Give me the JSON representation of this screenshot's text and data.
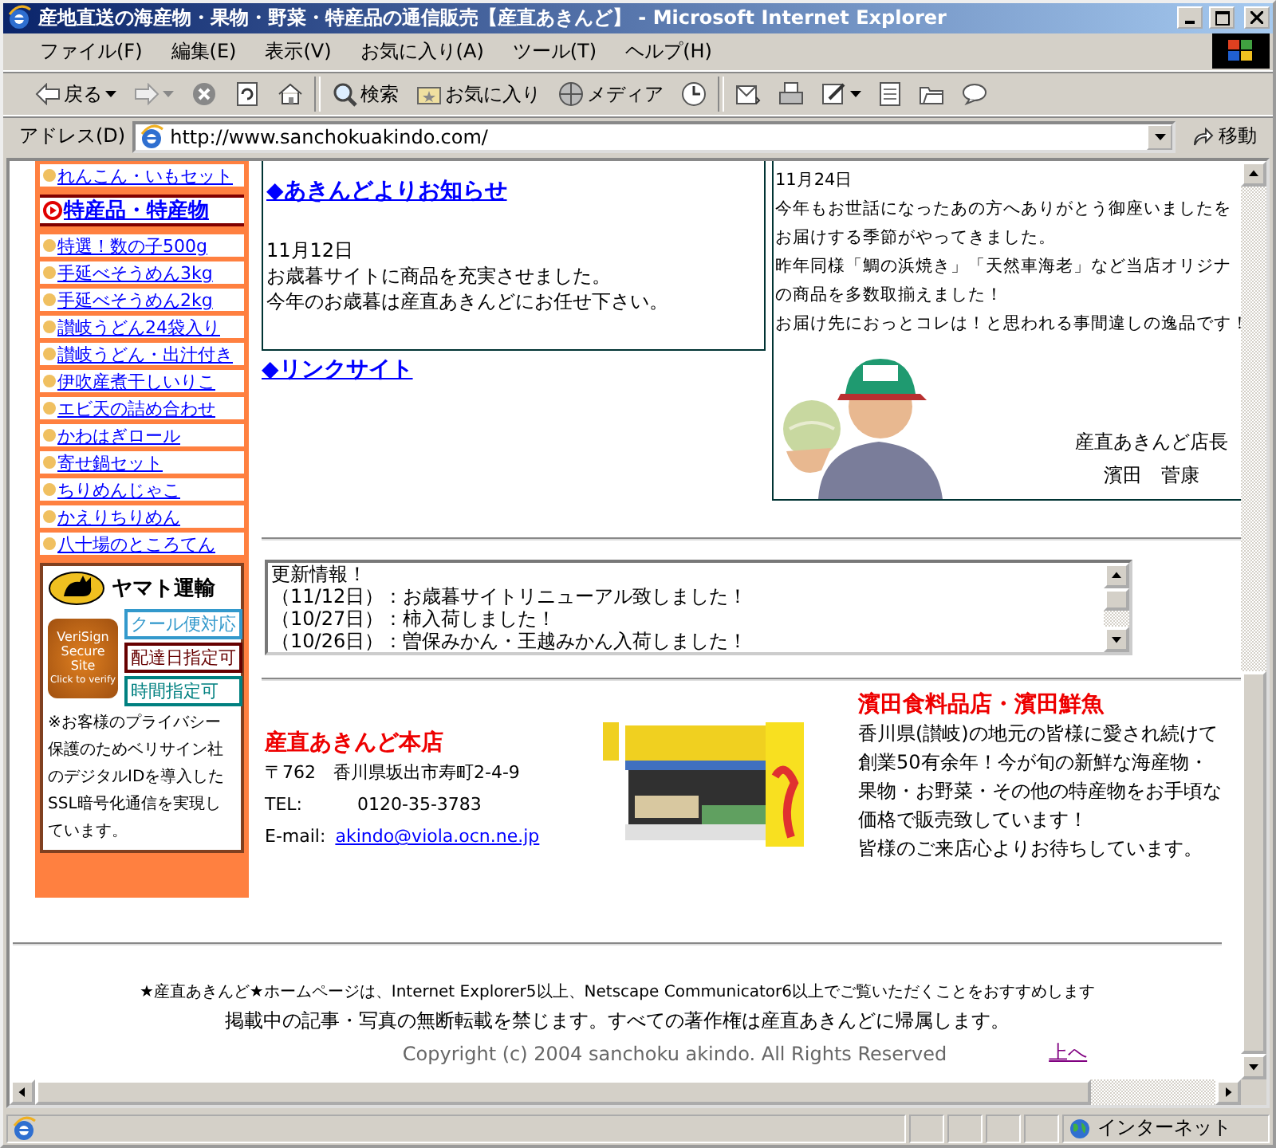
{
  "window": {
    "title": "産地直送の海産物・果物・野菜・特産品の通信販売【産直あきんど】 - Microsoft Internet Explorer"
  },
  "menu": [
    "ファイル(F)",
    "編集(E)",
    "表示(V)",
    "お気に入り(A)",
    "ツール(T)",
    "ヘルプ(H)"
  ],
  "toolbar": [
    {
      "kind": "back",
      "label": "戻る"
    },
    {
      "kind": "forward"
    },
    {
      "kind": "stop"
    },
    {
      "kind": "refresh"
    },
    {
      "kind": "home"
    },
    {
      "kind": "sep"
    },
    {
      "kind": "search",
      "label": "検索"
    },
    {
      "kind": "favorites",
      "label": "お気に入り"
    },
    {
      "kind": "media",
      "label": "メディア"
    },
    {
      "kind": "history"
    },
    {
      "kind": "sep"
    },
    {
      "kind": "mail"
    },
    {
      "kind": "print"
    },
    {
      "kind": "edit"
    },
    {
      "kind": "document"
    },
    {
      "kind": "folder"
    },
    {
      "kind": "chat"
    }
  ],
  "address": {
    "label": "アドレス(D)",
    "url": "http://www.sanchokuakindo.com/",
    "go": "移動"
  },
  "sidebar": {
    "items": [
      {
        "kind": "link",
        "label": "れんこん・いもセット"
      },
      {
        "kind": "heading",
        "label": "特産品・特産物"
      },
      {
        "kind": "link",
        "label": "特選！数の子500g"
      },
      {
        "kind": "link",
        "label": "手延べそうめん3kg"
      },
      {
        "kind": "link",
        "label": "手延べそうめん2kg"
      },
      {
        "kind": "link",
        "label": "讃岐うどん24袋入り"
      },
      {
        "kind": "link",
        "label": "讃岐うどん・出汁付き"
      },
      {
        "kind": "link",
        "label": "伊吹産煮干しいりこ"
      },
      {
        "kind": "link",
        "label": "エビ天の詰め合わせ"
      },
      {
        "kind": "link",
        "label": "かわはぎロール"
      },
      {
        "kind": "link",
        "label": "寄せ鍋セット"
      },
      {
        "kind": "link",
        "label": "ちりめんじゃこ"
      },
      {
        "kind": "link",
        "label": "かえりちりめん"
      },
      {
        "kind": "link",
        "label": "八十場のところてん"
      }
    ],
    "badge": {
      "title": "ヤマト運輸",
      "seal": [
        "VeriSign",
        "Secure",
        "Site",
        "Click to verify"
      ],
      "tags": [
        {
          "label": "クール便対応",
          "color": "#3399cc"
        },
        {
          "label": "配達日指定可",
          "color": "#660000"
        },
        {
          "label": "時間指定可",
          "color": "#008080"
        }
      ],
      "note": "※お客様のプライバシー保護のためベリサイン社のデジタルIDを導入したSSL暗号化通信を実現しています。"
    }
  },
  "news": {
    "heading": "◆あきんどよりお知らせ",
    "date": "11月12日",
    "lines": [
      "お歳暮サイトに商品を充実させました。",
      "今年のお歳暮は産直あきんどにお任せ下さい。"
    ]
  },
  "link_heading": "◆リンクサイト",
  "message": {
    "date": "11月24日",
    "lines": [
      "今年もお世話になったあの方へありがとう御座いましたを",
      "お届けする季節がやってきました。",
      "昨年同様「鯛の浜焼き」「天然車海老」など当店オリジナ",
      "の商品を多数取揃えました！",
      "お届け先におっとコレは！と思われる事間違しの逸品です！"
    ],
    "signature": [
      "産直あきんど店長",
      "濱田　菅康"
    ]
  },
  "updates": {
    "title": "更新情報！",
    "lines": [
      "（11/12日）：お歳暮サイトリニューアル致しました！",
      "（10/27日）：柿入荷しました！",
      "（10/26日）：曽保みかん・王越みかん入荷しました！"
    ]
  },
  "shop": {
    "name": "産直あきんど本店",
    "address": "〒762　香川県坂出市寿町2-4-9",
    "tel_label": "TEL:",
    "tel": "0120-35-3783",
    "email_label": "E-mail:",
    "email": "akindo@viola.ocn.ne.jp"
  },
  "partner": {
    "name": "濱田食料品店・濱田鮮魚",
    "lines": [
      "香川県(讃岐)の地元の皆様に愛され続けて",
      "創業50有余年！今が旬の新鮮な海産物・",
      "果物・お野菜・その他の特産物をお手頃な",
      "価格で販売致しています！",
      "皆様のご来店心よりお待ちしています。"
    ]
  },
  "footer": {
    "notice": "★産直あきんど★ホームページは、Internet Explorer5以上、Netscape Communicator6以上でご覧いただくことをおすすめします",
    "rights": "掲載中の記事・写真の無断転載を禁じます。すべての著作権は産直あきんどに帰属します。",
    "copyright": "Copyright (c) 2004 sanchoku akindo. All Rights Reserved",
    "top_link": "上へ"
  },
  "status": {
    "zone": "インターネット"
  }
}
